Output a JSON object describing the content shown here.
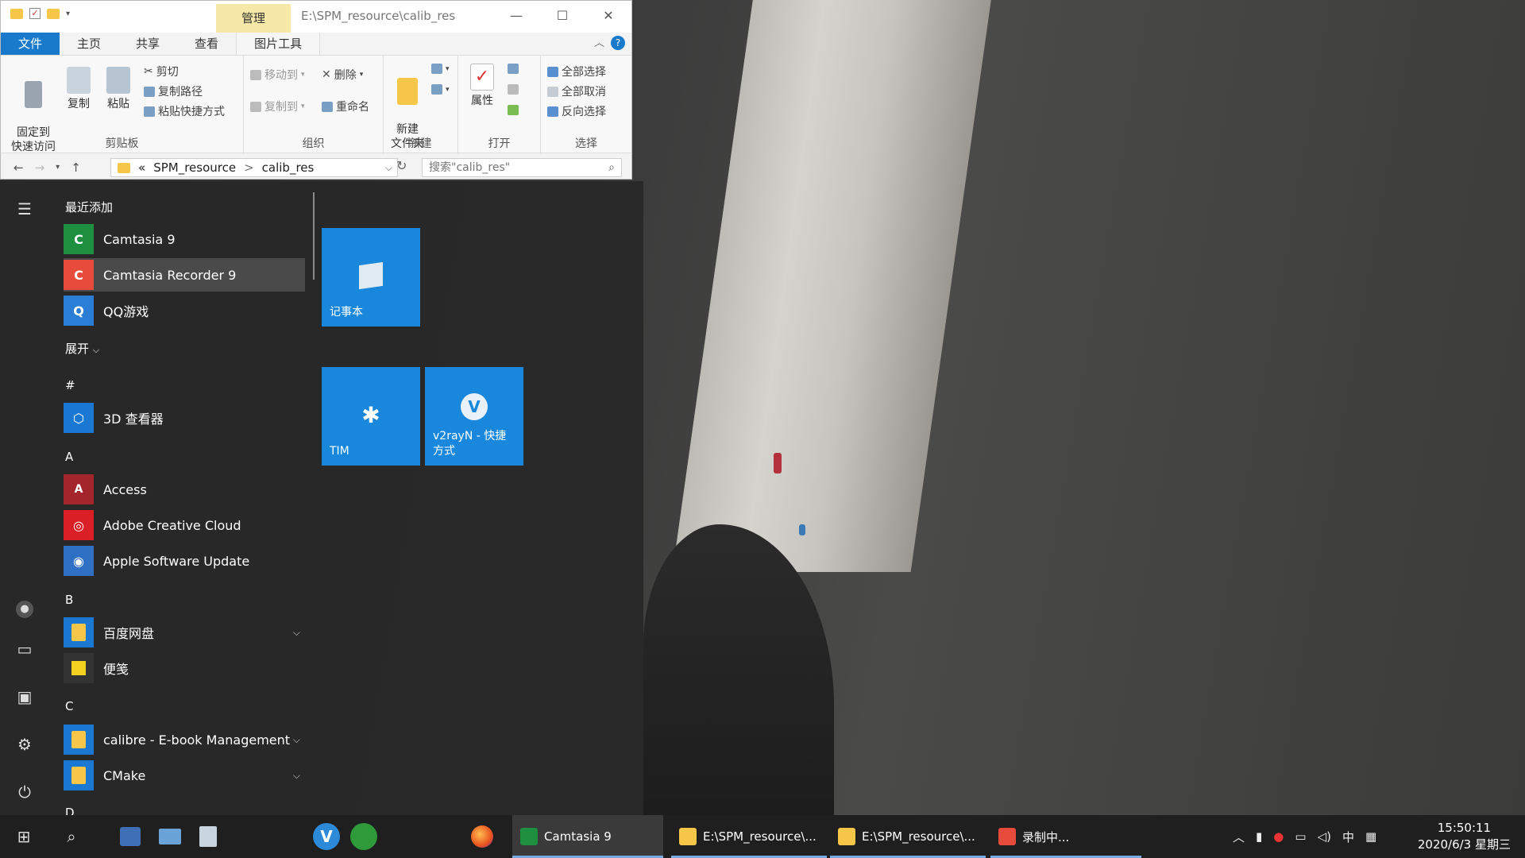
{
  "explorer": {
    "manage_tab": "管理",
    "title_path": "E:\\SPM_resource\\calib_res",
    "tabs": [
      "文件",
      "主页",
      "共享",
      "查看",
      "图片工具"
    ],
    "help": "?",
    "clipboard": {
      "pin": "固定到\n快速访问",
      "copy": "复制",
      "paste": "粘贴",
      "cut": "剪切",
      "copy_path": "复制路径",
      "paste_shortcut": "粘贴快捷方式",
      "label": "剪贴板"
    },
    "organize": {
      "move_to": "移动到",
      "copy_to": "复制到",
      "delete": "删除",
      "rename": "重命名",
      "label": "组织"
    },
    "new": {
      "new_folder": "新建\n文件夹",
      "label": "新建"
    },
    "open": {
      "properties": "属性",
      "label": "打开"
    },
    "select": {
      "select_all": "全部选择",
      "select_none": "全部取消",
      "invert": "反向选择",
      "label": "选择"
    },
    "address": {
      "crumb_sep": "«",
      "crumb1": "SPM_resource",
      "sep": ">",
      "crumb2": "calib_res"
    },
    "search_placeholder": "搜索\"calib_res\""
  },
  "start": {
    "recent_header": "最近添加",
    "recent": [
      "Camtasia 9",
      "Camtasia Recorder 9",
      "QQ游戏"
    ],
    "expand": "展开",
    "hash_header": "#",
    "hash_apps": [
      "3D 查看器"
    ],
    "a_header": "A",
    "a_apps": [
      "Access",
      "Adobe Creative Cloud",
      "Apple Software Update"
    ],
    "b_header": "B",
    "b_apps": [
      "百度网盘",
      "便笺"
    ],
    "c_header": "C",
    "c_apps": [
      "calibre - E-book Management",
      "CMake"
    ],
    "d_header": "D",
    "tiles": {
      "notepad": "记事本",
      "tim": "TIM",
      "v2ray": "v2rayN - 快捷\n方式"
    }
  },
  "taskbar": {
    "apps": [
      {
        "label": "Camtasia 9"
      },
      {
        "label": "E:\\SPM_resource\\..."
      },
      {
        "label": "E:\\SPM_resource\\..."
      },
      {
        "label": "录制中..."
      }
    ],
    "ime": "中",
    "time": "15:50:11",
    "date": "2020/6/3 星期三"
  },
  "colors": {
    "accent": "#1979ca",
    "tile": "#1987dc",
    "manage_tab": "#f6e8a6",
    "taskbar": "#1f1f1f"
  }
}
